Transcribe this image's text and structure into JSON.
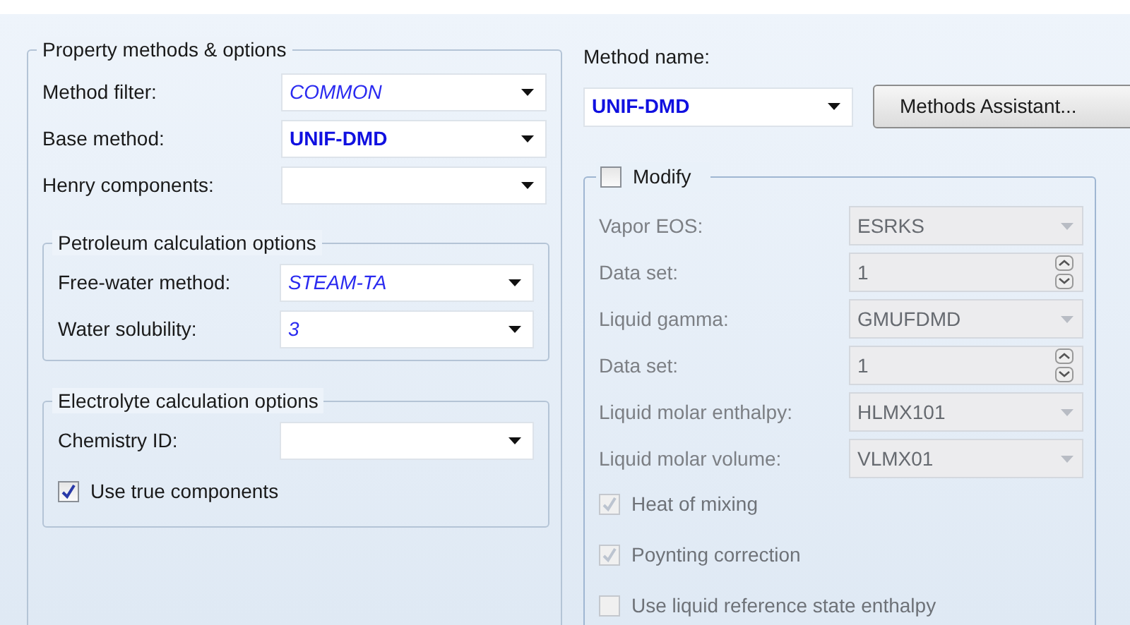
{
  "property_methods": {
    "title": "Property methods & options",
    "fields": [
      {
        "label": "Method filter:",
        "value": "COMMON",
        "kind": "italic"
      },
      {
        "label": "Base method:",
        "value": "UNIF-DMD",
        "kind": "bold"
      },
      {
        "label": "Henry components:"
      }
    ],
    "petroleum": {
      "title": "Petroleum calculation options",
      "fields": [
        {
          "label": "Free-water method:",
          "value": "STEAM-TA",
          "kind": "italic"
        },
        {
          "label": "Water solubility:",
          "value": "3",
          "kind": "italic"
        }
      ]
    },
    "electrolyte": {
      "title": "Electrolyte calculation options",
      "fields": [
        {
          "label": "Chemistry ID:"
        }
      ],
      "checkbox": {
        "label": "Use true components",
        "checked": true
      }
    }
  },
  "method_name": {
    "label": "Method name:",
    "value": "UNIF-DMD",
    "button": "Methods Assistant..."
  },
  "modify": {
    "label": "Modify",
    "checked": false,
    "fields": [
      {
        "label": "Vapor EOS:",
        "value": "ESRKS",
        "kind": "dropdown",
        "disabled": true
      },
      {
        "label": "Data set:",
        "value": "1",
        "kind": "spinner",
        "disabled": true
      },
      {
        "label": "Liquid gamma:",
        "value": "GMUFDMD",
        "kind": "dropdown",
        "disabled": true
      },
      {
        "label": "Data set:",
        "value": "1",
        "kind": "spinner",
        "disabled": true
      },
      {
        "label": "Liquid molar enthalpy:",
        "value": "HLMX101",
        "kind": "dropdown",
        "disabled": true
      },
      {
        "label": "Liquid molar volume:",
        "value": "VLMX01",
        "kind": "dropdown",
        "disabled": true
      }
    ],
    "checkboxes": [
      {
        "label": "Heat of mixing",
        "checked": true,
        "disabled": true
      },
      {
        "label": "Poynting correction",
        "checked": true,
        "disabled": true
      },
      {
        "label": "Use liquid reference state enthalpy",
        "checked": false,
        "disabled": true
      }
    ]
  }
}
